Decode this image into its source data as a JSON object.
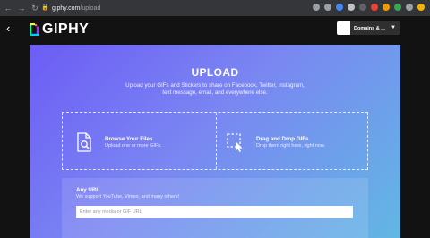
{
  "browser": {
    "url_host": "giphy.com",
    "url_path": "/upload",
    "extensions": [
      {
        "name": "key-icon",
        "color": "#9aa0a6"
      },
      {
        "name": "star-icon",
        "color": "#9aa0a6"
      },
      {
        "name": "extension-blue-icon",
        "color": "#4285f4"
      },
      {
        "name": "extension-gray-icon",
        "color": "#bdc1c6"
      },
      {
        "name": "extension-dark-icon",
        "color": "#5f6368"
      },
      {
        "name": "extension-red-icon",
        "color": "#ea4335"
      },
      {
        "name": "extension-orange-icon",
        "color": "#f29900"
      },
      {
        "name": "extension-green-icon",
        "color": "#34a853"
      },
      {
        "name": "puzzle-icon",
        "color": "#9aa0a6"
      },
      {
        "name": "profile-icon",
        "color": "#f4b400"
      }
    ]
  },
  "header": {
    "logo_text": "GIPHY",
    "account_name": "Domains & ..."
  },
  "upload": {
    "title": "UPLOAD",
    "description": "Upload your GIFs and Stickers to share on Facebook, Twitter, Instagram, text message, email, and everywhere else.",
    "browse_title": "Browse Your Files",
    "browse_sub": "Upload one or more GIFs.",
    "drag_title": "Drag and Drop GIFs",
    "drag_sub": "Drop them right here, right now.",
    "url_label": "Any URL",
    "url_sub": "We support YouTube, Vimeo, and many others!",
    "url_placeholder": "Enter any media or GIF URL"
  },
  "colors": {
    "panel_gradient": [
      "#6c5cf6",
      "#7a86f2",
      "#62b7e4"
    ],
    "background": "#121212"
  }
}
